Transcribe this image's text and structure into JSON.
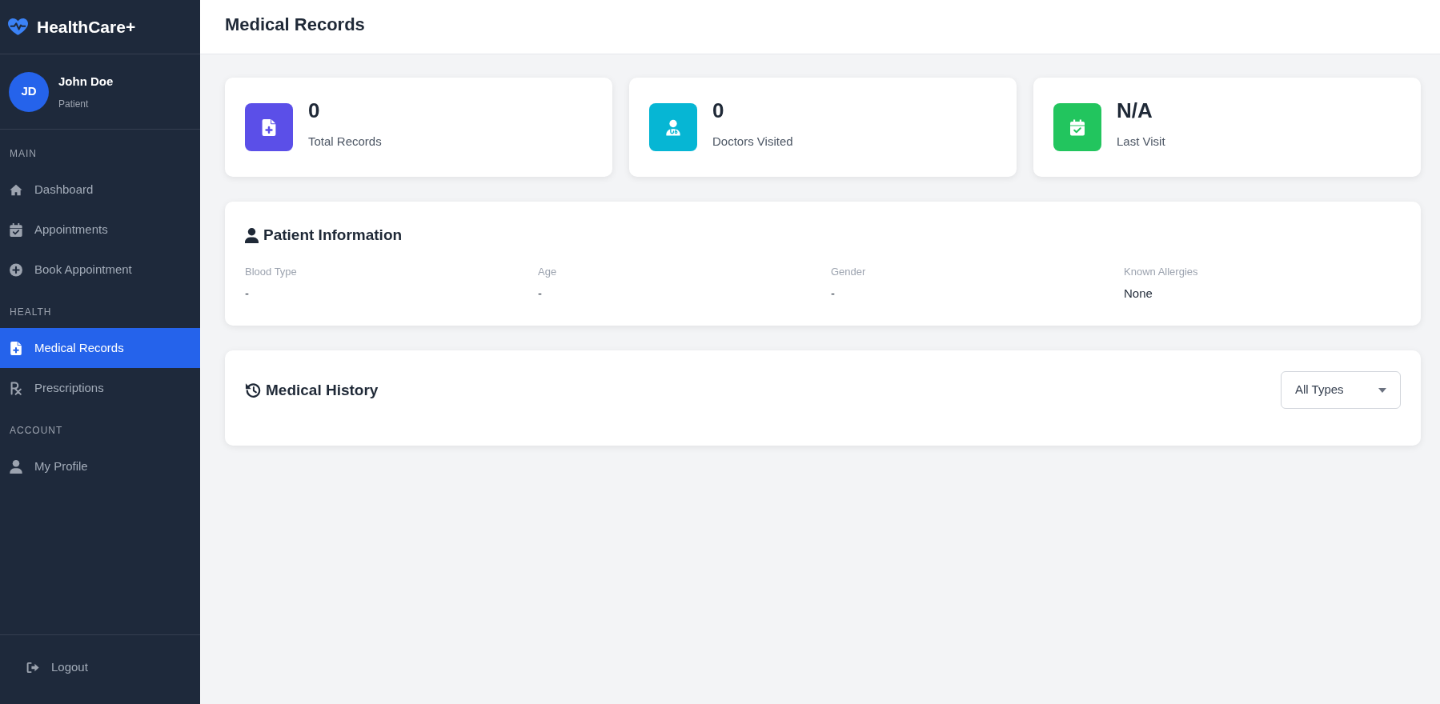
{
  "brand": {
    "name": "HealthCare+"
  },
  "user": {
    "initials": "JD",
    "name": "John Doe",
    "role": "Patient"
  },
  "sidebar": {
    "sections": [
      {
        "label": "MAIN",
        "items": [
          {
            "label": "Dashboard",
            "selected": false
          },
          {
            "label": "Appointments",
            "selected": false
          },
          {
            "label": "Book Appointment",
            "selected": false
          }
        ]
      },
      {
        "label": "HEALTH",
        "items": [
          {
            "label": "Medical Records",
            "selected": true
          },
          {
            "label": "Prescriptions",
            "selected": false
          }
        ]
      },
      {
        "label": "ACCOUNT",
        "items": [
          {
            "label": "My Profile",
            "selected": false
          }
        ]
      }
    ],
    "logout": {
      "label": "Logout"
    }
  },
  "header": {
    "title": "Medical Records"
  },
  "stats": [
    {
      "value": "0",
      "label": "Total Records",
      "color": "#5b4fe8"
    },
    {
      "value": "0",
      "label": "Doctors Visited",
      "color": "#06b6d4"
    },
    {
      "value": "N/A",
      "label": "Last Visit",
      "color": "#22c55e"
    }
  ],
  "patient_information": {
    "title": "Patient Information",
    "fields": [
      {
        "label": "Blood Type",
        "value": "-"
      },
      {
        "label": "Age",
        "value": "-"
      },
      {
        "label": "Gender",
        "value": "-"
      },
      {
        "label": "Known Allergies",
        "value": "None"
      }
    ]
  },
  "medical_history": {
    "title": "Medical History",
    "filter": {
      "value": "All Types"
    }
  }
}
